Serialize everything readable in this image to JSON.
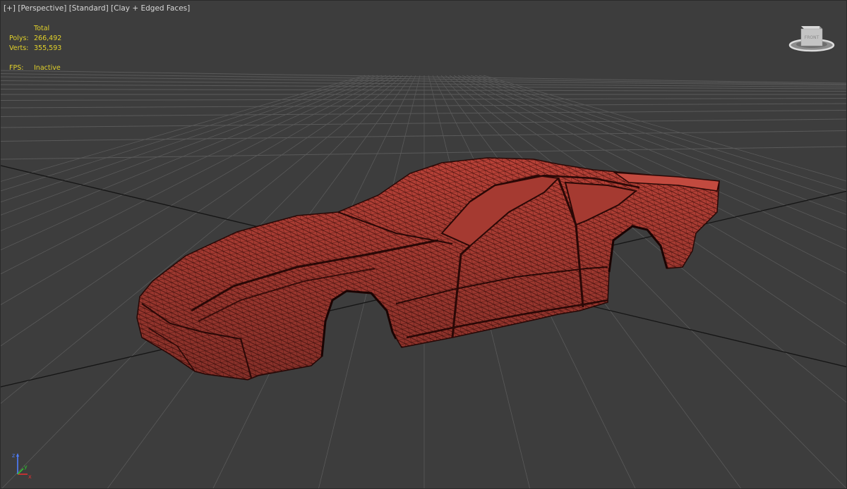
{
  "viewport": {
    "label_plus": "[+]",
    "label_view": "[Perspective]",
    "label_shading_preset": "[Standard]",
    "label_shading_mode": "[Clay + Edged Faces]"
  },
  "stats": {
    "header": "Total",
    "polys_label": "Polys:",
    "polys_value": "266,492",
    "verts_label": "Verts:",
    "verts_value": "355,593",
    "fps_label": "FPS:",
    "fps_value": "Inactive"
  },
  "viewcube": {
    "face_label": "FRONT"
  },
  "axis_tripod": {
    "x_label": "x",
    "y_label": "y",
    "z_label": "z"
  },
  "colors": {
    "background": "#3d3d3d",
    "grid": "#5a5a5a",
    "grid_major": "#151515",
    "mesh_fill": "#b84137",
    "mesh_wire": "#3a0d0a",
    "stats_text": "#e2d22a",
    "label_text": "#d8d8d8"
  }
}
